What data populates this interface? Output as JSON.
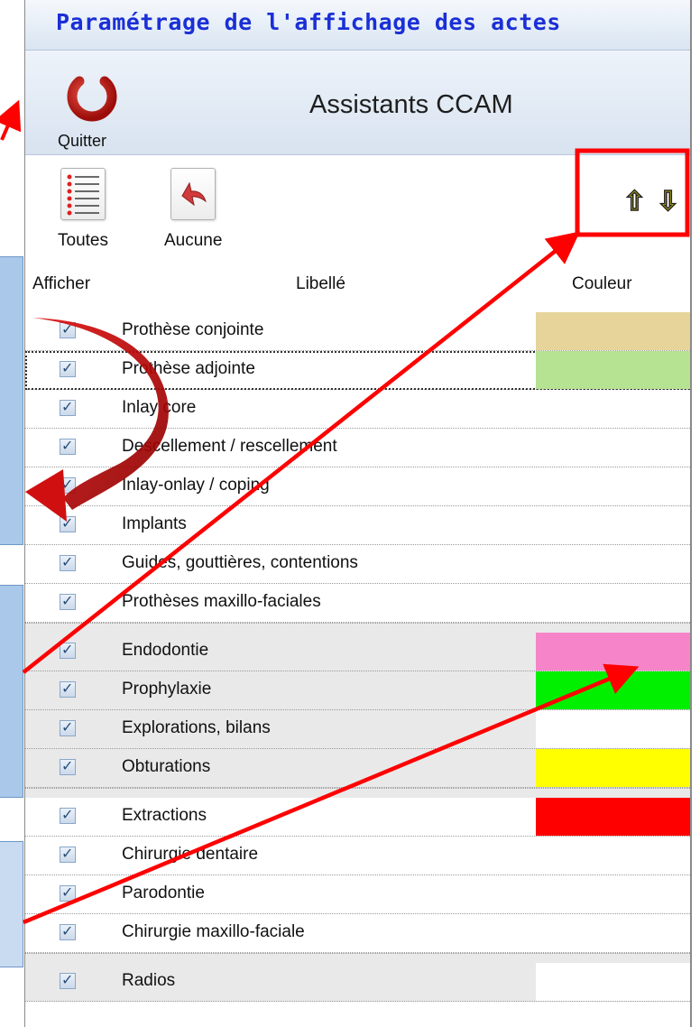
{
  "window": {
    "title": "Paramétrage de l'affichage des actes"
  },
  "ribbon": {
    "quit_label": "Quitter",
    "title": "Assistants CCAM"
  },
  "toolbar": {
    "all_label": "Toutes",
    "none_label": "Aucune",
    "up_icon": "arrow-up-icon",
    "down_icon": "arrow-down-icon"
  },
  "columns": {
    "show": "Afficher",
    "label": "Libellé",
    "color": "Couleur"
  },
  "groups": [
    {
      "rows": [
        {
          "label": "Prothèse conjointe",
          "checked": true,
          "color": "#e6d49a"
        },
        {
          "label": "Prothèse adjointe",
          "checked": true,
          "color": "#b6e392"
        },
        {
          "label": "Inlay core",
          "checked": true,
          "color": null
        },
        {
          "label": "Descellement / rescellement",
          "checked": true,
          "color": null
        },
        {
          "label": "Inlay-onlay / coping",
          "checked": true,
          "color": null
        },
        {
          "label": "Implants",
          "checked": true,
          "color": null
        },
        {
          "label": "Guides, gouttières, contentions",
          "checked": true,
          "color": null
        },
        {
          "label": "Prothèses maxillo-faciales",
          "checked": true,
          "color": null
        }
      ]
    },
    {
      "rows": [
        {
          "label": "Endodontie",
          "checked": true,
          "color": "#f585c8"
        },
        {
          "label": "Prophylaxie",
          "checked": true,
          "color": "#00f000"
        },
        {
          "label": "Explorations, bilans",
          "checked": true,
          "color": "#ffffff"
        },
        {
          "label": "Obturations",
          "checked": true,
          "color": "#ffff00"
        }
      ]
    },
    {
      "rows": [
        {
          "label": "Extractions",
          "checked": true,
          "color": "#ff0000"
        },
        {
          "label": "Chirurgie dentaire",
          "checked": true,
          "color": null
        },
        {
          "label": "Parodontie",
          "checked": true,
          "color": null
        },
        {
          "label": "Chirurgie maxillo-faciale",
          "checked": true,
          "color": null
        }
      ]
    },
    {
      "rows": [
        {
          "label": "Radios",
          "checked": true,
          "color": "#ffffff"
        }
      ]
    }
  ],
  "colors": {
    "title_text": "#1a2fd6",
    "annotation_red": "#ff0000",
    "callout_blue": "#a9c8ea"
  }
}
